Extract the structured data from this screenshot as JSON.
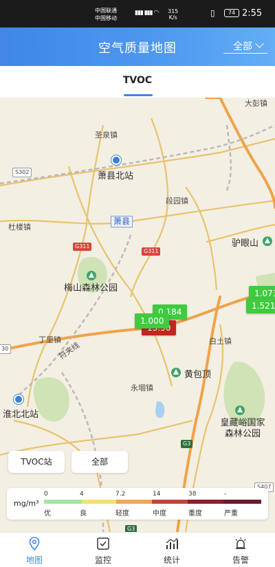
{
  "status_bar": {
    "carrier1": "中国联通",
    "carrier2": "中国移动",
    "speed": "315",
    "speed_unit": "K/s",
    "battery": "74",
    "time": "2:55"
  },
  "header": {
    "title": "空气质量地图",
    "filter_label": "全部"
  },
  "tabs": [
    {
      "label": "TVOC",
      "active": true
    }
  ],
  "map": {
    "places": {
      "dapeng": "大彭镇",
      "shengquan": "圣泉镇",
      "xiaoxian_north": "萧县北站",
      "duanyuan": "段园镇",
      "dulou": "杜楼镇",
      "xiaoxian": "萧县",
      "lvyanshan": "驴眼山",
      "meishan": "梅山森林公园",
      "dingli": "丁里镇",
      "baitu": "白土镇",
      "huangbaoding": "黄包顶",
      "yongdui": "永堌镇",
      "huaibei_north": "淮北北站",
      "huangcangyu": "皇藏峪国家森林公园",
      "railway": "符夹线"
    },
    "road_labels": [
      "S302",
      "G311",
      "G311",
      "G3",
      "G3",
      "S407",
      "30"
    ],
    "markers": [
      {
        "label": "0.184",
        "status": "good"
      },
      {
        "label": "13.50",
        "status": "severe"
      },
      {
        "label": "1.000",
        "status": "good"
      },
      {
        "label": "1.073",
        "status": "good"
      },
      {
        "label": "1.521",
        "status": "good"
      }
    ],
    "buttons": {
      "station": "TVOC站",
      "all": "全部"
    }
  },
  "legend": {
    "unit": "mg/m³",
    "ticks": [
      "0",
      "4",
      "7.2",
      "14",
      "38",
      "-"
    ],
    "levels": [
      "优",
      "良",
      "轻度",
      "中度",
      "重度",
      "严重"
    ],
    "colors": [
      "#a3e5a3",
      "#f1e36a",
      "#f0a65a",
      "#c1453a",
      "#8a1f30",
      "#6b1b2e"
    ]
  },
  "nav": {
    "items": [
      {
        "label": "地图",
        "icon": "map-pin-icon",
        "active": true
      },
      {
        "label": "监控",
        "icon": "monitor-check-icon",
        "active": false
      },
      {
        "label": "统计",
        "icon": "stats-chart-icon",
        "active": false
      },
      {
        "label": "告警",
        "icon": "alarm-icon",
        "active": false
      }
    ]
  }
}
